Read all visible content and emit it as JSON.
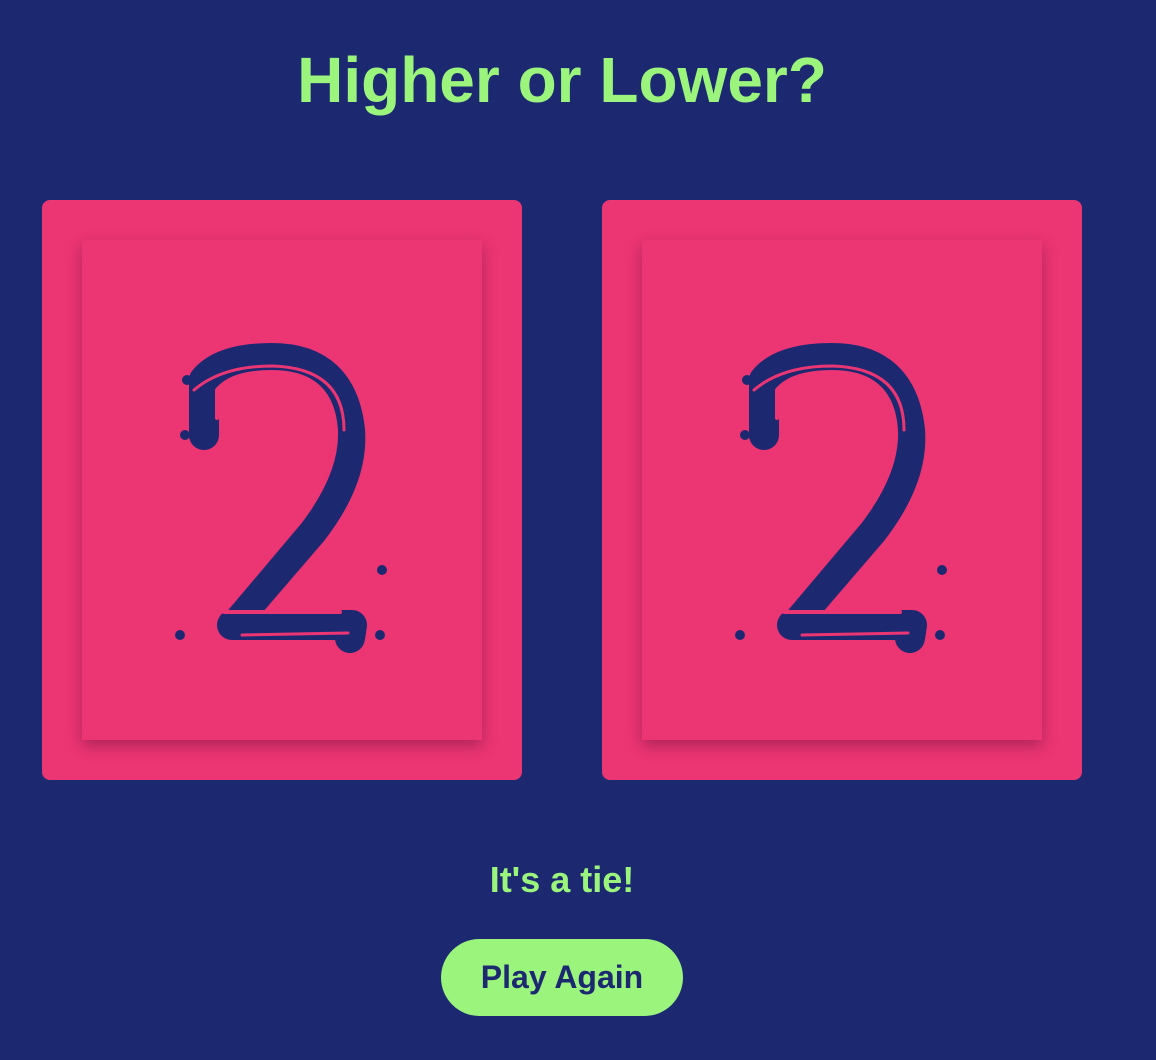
{
  "game": {
    "title": "Higher or Lower?",
    "result_text": "It's a tie!",
    "play_again_label": "Play Again"
  },
  "cards": [
    {
      "value": "2"
    },
    {
      "value": "2"
    }
  ],
  "colors": {
    "background": "#1c2971",
    "card": "#ec3573",
    "accent": "#9bf57d",
    "digit": "#1c2971"
  }
}
